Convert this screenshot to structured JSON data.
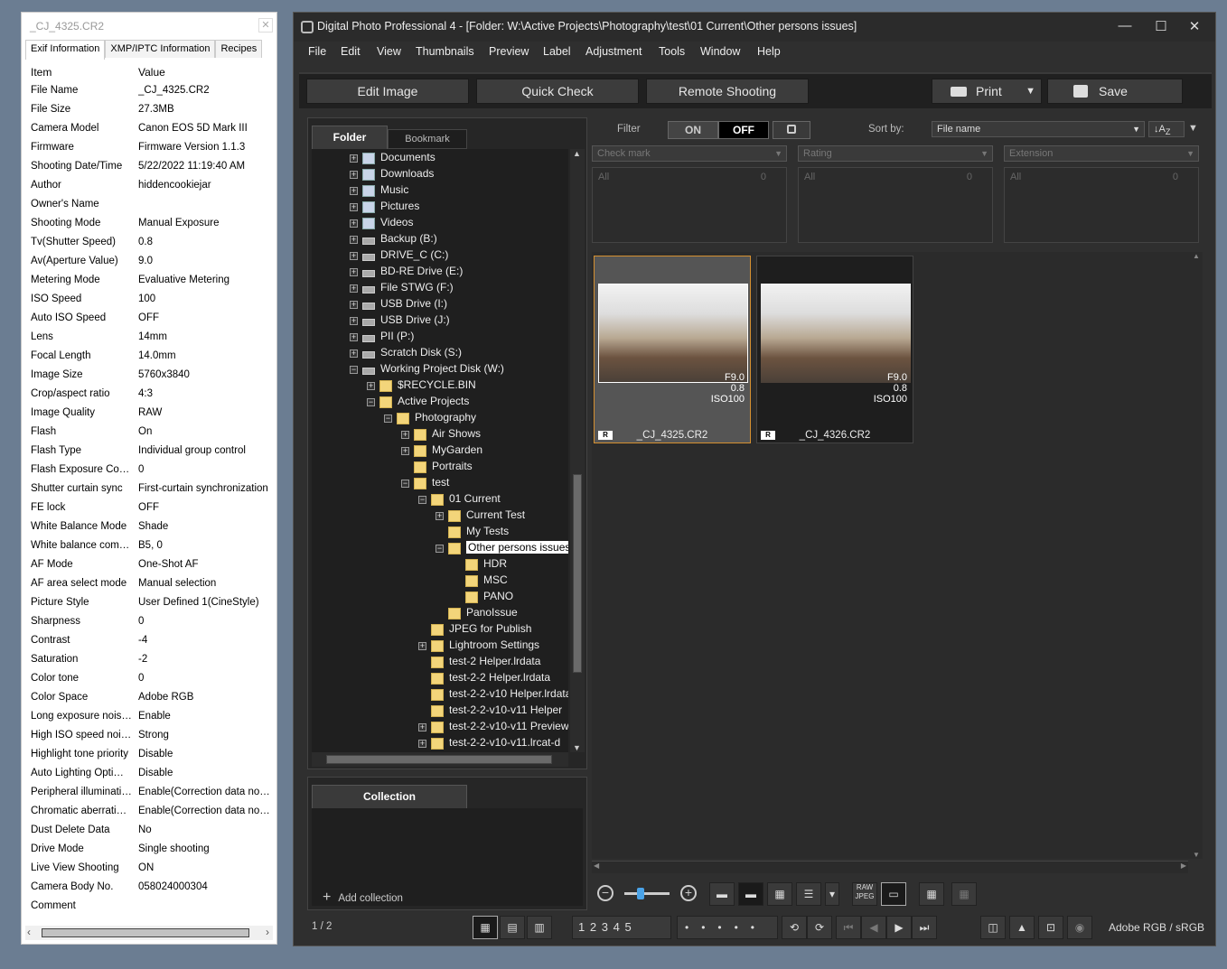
{
  "info_panel": {
    "title": "_CJ_4325.CR2",
    "close": "✕",
    "tabs": [
      "Exif Information",
      "XMP/IPTC Information",
      "Recipes"
    ],
    "header": {
      "item": "Item",
      "value": "Value"
    },
    "rows": [
      [
        "File Name",
        "_CJ_4325.CR2"
      ],
      [
        "File Size",
        "27.3MB"
      ],
      [
        "Camera Model",
        "Canon EOS 5D Mark III"
      ],
      [
        "Firmware",
        "Firmware Version 1.1.3"
      ],
      [
        "Shooting Date/Time",
        "5/22/2022 11:19:40 AM"
      ],
      [
        "Author",
        "hiddencookiejar"
      ],
      [
        "Owner's Name",
        ""
      ],
      [
        "Shooting Mode",
        "Manual Exposure"
      ],
      [
        "Tv(Shutter Speed)",
        "0.8"
      ],
      [
        "Av(Aperture Value)",
        "9.0"
      ],
      [
        "Metering Mode",
        "Evaluative Metering"
      ],
      [
        "ISO Speed",
        "100"
      ],
      [
        "Auto ISO Speed",
        "OFF"
      ],
      [
        "Lens",
        "14mm"
      ],
      [
        "Focal Length",
        "14.0mm"
      ],
      [
        "Image Size",
        "5760x3840"
      ],
      [
        "Crop/aspect ratio",
        "4:3"
      ],
      [
        "Image Quality",
        "RAW"
      ],
      [
        "Flash",
        "On"
      ],
      [
        "Flash Type",
        "Individual group control"
      ],
      [
        "Flash Exposure Comp...",
        "0"
      ],
      [
        "Shutter curtain sync",
        "First-curtain synchronization"
      ],
      [
        "FE lock",
        "OFF"
      ],
      [
        "White Balance Mode",
        "Shade"
      ],
      [
        "White balance comp...",
        "B5, 0"
      ],
      [
        "AF Mode",
        "One-Shot AF"
      ],
      [
        "AF area select mode",
        "Manual selection"
      ],
      [
        "Picture Style",
        "User Defined 1(CineStyle)"
      ],
      [
        "Sharpness",
        "0"
      ],
      [
        "Contrast",
        "-4"
      ],
      [
        "Saturation",
        "-2"
      ],
      [
        "Color tone",
        "0"
      ],
      [
        "Color Space",
        "Adobe RGB"
      ],
      [
        "Long exposure noise ...",
        "Enable"
      ],
      [
        "High ISO speed nois...",
        "Strong"
      ],
      [
        "Highlight tone priority",
        "Disable"
      ],
      [
        "Auto Lighting Optimizer",
        "Disable"
      ],
      [
        "Peripheral illumination...",
        "Enable(Correction data not a..."
      ],
      [
        "Chromatic aberration ...",
        "Enable(Correction data not a..."
      ],
      [
        "Dust Delete Data",
        "No"
      ],
      [
        "Drive Mode",
        "Single shooting"
      ],
      [
        "Live View Shooting",
        "ON"
      ],
      [
        "Camera Body No.",
        "058024000304"
      ],
      [
        "Comment",
        ""
      ]
    ]
  },
  "window": {
    "title": "Digital Photo Professional 4 - [Folder: W:\\Active Projects\\Photography\\test\\01 Current\\Other persons issues]",
    "minimize": "—",
    "maximize": "☐",
    "close": "✕",
    "menu": [
      "File",
      "Edit",
      "View",
      "Thumbnails",
      "Preview",
      "Label",
      "Adjustment",
      "Tools",
      "Window",
      "Help"
    ]
  },
  "toolbar": {
    "edit_image": "Edit Image",
    "quick_check": "Quick Check",
    "remote_shooting": "Remote Shooting",
    "print": "Print",
    "save": "Save"
  },
  "folder_panel": {
    "tab_folder": "Folder",
    "tab_bookmark": "Bookmark",
    "tree": [
      {
        "label": "Documents",
        "indent": 0,
        "icon": "lib",
        "pm": "+"
      },
      {
        "label": "Downloads",
        "indent": 0,
        "icon": "lib",
        "pm": "+"
      },
      {
        "label": "Music",
        "indent": 0,
        "icon": "lib",
        "pm": "+"
      },
      {
        "label": "Pictures",
        "indent": 0,
        "icon": "lib",
        "pm": "+"
      },
      {
        "label": "Videos",
        "indent": 0,
        "icon": "lib",
        "pm": "+"
      },
      {
        "label": "Backup (B:)",
        "indent": 0,
        "icon": "drive",
        "pm": "+"
      },
      {
        "label": "DRIVE_C (C:)",
        "indent": 0,
        "icon": "drive",
        "pm": "+"
      },
      {
        "label": "BD-RE Drive (E:)",
        "indent": 0,
        "icon": "drive",
        "pm": "+"
      },
      {
        "label": "File STWG (F:)",
        "indent": 0,
        "icon": "drive",
        "pm": "+"
      },
      {
        "label": "USB Drive (I:)",
        "indent": 0,
        "icon": "drive",
        "pm": "+"
      },
      {
        "label": "USB Drive (J:)",
        "indent": 0,
        "icon": "drive",
        "pm": "+"
      },
      {
        "label": "PII (P:)",
        "indent": 0,
        "icon": "drive",
        "pm": "+"
      },
      {
        "label": "Scratch Disk (S:)",
        "indent": 0,
        "icon": "drive",
        "pm": "+"
      },
      {
        "label": "Working Project Disk (W:)",
        "indent": 0,
        "icon": "drive",
        "pm": "−"
      },
      {
        "label": "$RECYCLE.BIN",
        "indent": 1,
        "icon": "folder",
        "pm": "+"
      },
      {
        "label": "Active Projects",
        "indent": 1,
        "icon": "folder",
        "pm": "−"
      },
      {
        "label": "Photography",
        "indent": 2,
        "icon": "folder",
        "pm": "−"
      },
      {
        "label": "Air Shows",
        "indent": 3,
        "icon": "folder",
        "pm": "+"
      },
      {
        "label": "MyGarden",
        "indent": 3,
        "icon": "folder",
        "pm": "+"
      },
      {
        "label": "Portraits",
        "indent": 3,
        "icon": "folder",
        "pm": ""
      },
      {
        "label": "test",
        "indent": 3,
        "icon": "folder",
        "pm": "−"
      },
      {
        "label": "01 Current",
        "indent": 4,
        "icon": "folder",
        "pm": "−"
      },
      {
        "label": "Current Test",
        "indent": 5,
        "icon": "folder",
        "pm": "+"
      },
      {
        "label": "My Tests",
        "indent": 5,
        "icon": "folder",
        "pm": ""
      },
      {
        "label": "Other persons issues",
        "indent": 5,
        "icon": "folder",
        "pm": "−",
        "selected": true
      },
      {
        "label": "HDR",
        "indent": 6,
        "icon": "folder",
        "pm": ""
      },
      {
        "label": "MSC",
        "indent": 6,
        "icon": "folder",
        "pm": ""
      },
      {
        "label": "PANO",
        "indent": 6,
        "icon": "folder",
        "pm": ""
      },
      {
        "label": "PanoIssue",
        "indent": 5,
        "icon": "folder",
        "pm": ""
      },
      {
        "label": "JPEG for Publish",
        "indent": 4,
        "icon": "folder",
        "pm": ""
      },
      {
        "label": "Lightroom Settings",
        "indent": 4,
        "icon": "folder",
        "pm": "+"
      },
      {
        "label": "test-2 Helper.lrdata",
        "indent": 4,
        "icon": "folder",
        "pm": ""
      },
      {
        "label": "test-2-2 Helper.lrdata",
        "indent": 4,
        "icon": "folder",
        "pm": ""
      },
      {
        "label": "test-2-2-v10 Helper.lrdata",
        "indent": 4,
        "icon": "folder",
        "pm": ""
      },
      {
        "label": "test-2-2-v10-v11 Helper",
        "indent": 4,
        "icon": "folder",
        "pm": ""
      },
      {
        "label": "test-2-2-v10-v11 Preview",
        "indent": 4,
        "icon": "folder",
        "pm": "+"
      },
      {
        "label": "test-2-2-v10-v11.lrcat-d",
        "indent": 4,
        "icon": "folder",
        "pm": "+"
      }
    ]
  },
  "collection_panel": {
    "tab": "Collection",
    "add": "Add collection"
  },
  "filter": {
    "label": "Filter",
    "on": "ON",
    "off": "OFF",
    "sort_label": "Sort by:",
    "sort_value": "File name",
    "check_mark": "Check mark",
    "rating": "Rating",
    "extension": "Extension",
    "all": "All",
    "zero": "0"
  },
  "thumbnails": [
    {
      "name": "_CJ_4325.CR2",
      "aperture": "F9.0",
      "shutter": "0.8",
      "iso": "ISO100",
      "badge": "R",
      "selected": true
    },
    {
      "name": "_CJ_4326.CR2",
      "aperture": "F9.0",
      "shutter": "0.8",
      "iso": "ISO100",
      "badge": "R",
      "selected": false
    }
  ],
  "status": {
    "count": "1 / 2",
    "color_space": "Adobe RGB / sRGB",
    "ratings": [
      "1",
      "2",
      "3",
      "4",
      "5"
    ],
    "raw_jpeg": "RAW JPEG"
  }
}
